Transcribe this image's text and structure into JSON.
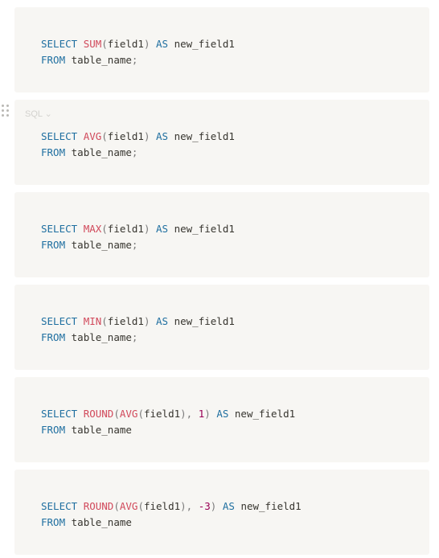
{
  "language_selector": {
    "label": "SQL",
    "chevron": "chevron-down-icon"
  },
  "drag_handle": {
    "icon": "drag-handle-icon"
  },
  "code_blocks": [
    {
      "line1": {
        "select": "SELECT",
        "func": "SUM",
        "open": "(",
        "arg": "field1",
        "close": ")",
        "as": "AS",
        "alias": "new_field1"
      },
      "line2": {
        "from": "FROM",
        "table": "table_name",
        "semi": ";"
      }
    },
    {
      "line1": {
        "select": "SELECT",
        "func": "AVG",
        "open": "(",
        "arg": "field1",
        "close": ")",
        "as": "AS",
        "alias": "new_field1"
      },
      "line2": {
        "from": "FROM",
        "table": "table_name",
        "semi": ";"
      }
    },
    {
      "line1": {
        "select": "SELECT",
        "func": "MAX",
        "open": "(",
        "arg": "field1",
        "close": ")",
        "as": "AS",
        "alias": "new_field1"
      },
      "line2": {
        "from": "FROM",
        "table": "table_name",
        "semi": ";"
      }
    },
    {
      "line1": {
        "select": "SELECT",
        "func": "MIN",
        "open": "(",
        "arg": "field1",
        "close": ")",
        "as": "AS",
        "alias": "new_field1"
      },
      "line2": {
        "from": "FROM",
        "table": "table_name",
        "semi": ";"
      }
    },
    {
      "line1": {
        "select": "SELECT",
        "func_outer": "ROUND",
        "open_outer": "(",
        "func_inner": "AVG",
        "open_inner": "(",
        "arg": "field1",
        "close_inner": ")",
        "comma": ",",
        "num": "1",
        "close_outer": ")",
        "as": "AS",
        "alias": "new_field1"
      },
      "line2": {
        "from": "FROM",
        "table": "table_name"
      }
    },
    {
      "line1": {
        "select": "SELECT",
        "func_outer": "ROUND",
        "open_outer": "(",
        "func_inner": "AVG",
        "open_inner": "(",
        "arg": "field1",
        "close_inner": ")",
        "comma": ",",
        "num": "-3",
        "close_outer": ")",
        "as": "AS",
        "alias": "new_field1"
      },
      "line2": {
        "from": "FROM",
        "table": "table_name"
      }
    }
  ],
  "colors": {
    "block_bg": "#f7f6f3",
    "keyword": "#1f6fa0",
    "function": "#d1495b",
    "number": "#990055",
    "text": "#37352f"
  }
}
